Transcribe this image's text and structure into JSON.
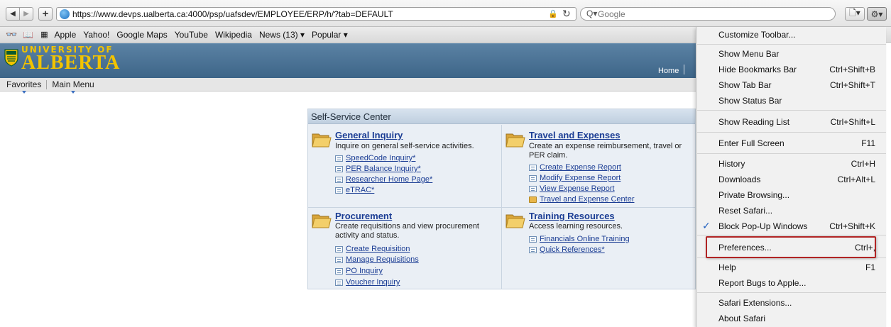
{
  "toolbar": {
    "back_glyph": "◀",
    "forward_glyph": "▶",
    "add_glyph": "+",
    "url": "https://www.devps.ualberta.ca:4000/psp/uafsdev/EMPLOYEE/ERP/h/?tab=DEFAULT",
    "lock_glyph": "🔒",
    "reload_glyph": "↻",
    "search_placeholder": "Google",
    "search_icon_glyph": "Q▾",
    "page_menu_glyph": "🗋▾",
    "gear_glyph": "⚙▾"
  },
  "bookmarks": {
    "reading_list_glyph": "👓",
    "book_glyph": "📖",
    "top_sites_glyph": "▦",
    "items": [
      "Apple",
      "Yahoo!",
      "Google Maps",
      "YouTube",
      "Wikipedia",
      "News (13) ▾",
      "Popular ▾"
    ]
  },
  "banner": {
    "logo_top": "UNIVERSITY OF",
    "logo_bottom": "ALBERTA",
    "home_link": "Home"
  },
  "page_nav": {
    "favorites": "Favorites",
    "main_menu": "Main Menu"
  },
  "ssc": {
    "header": "Self-Service Center",
    "sections": [
      {
        "title": "General Inquiry",
        "desc": "Inquire on general self-service activities.",
        "links": [
          "SpeedCode Inquiry*",
          "PER Balance Inquiry*",
          "Researcher Home Page*",
          "eTRAC*"
        ]
      },
      {
        "title": "Travel and Expenses",
        "desc": "Create an expense reimbursement, travel or PER claim.",
        "links": [
          "Create Expense Report",
          "Modify Expense Report",
          "View Expense Report",
          "Travel and Expense Center"
        ]
      },
      {
        "title": "Procurement",
        "desc": "Create requisitions and view procurement activity and status.",
        "links": [
          "Create Requisition",
          "Manage Requisitions",
          "PO Inquiry",
          "Voucher Inquiry"
        ]
      },
      {
        "title": "Training Resources",
        "desc": "Access learning resources.",
        "links": [
          "Financials Online Training",
          "Quick References*"
        ]
      }
    ]
  },
  "menu": {
    "check_glyph": "✓",
    "items": [
      {
        "label": "Customize Toolbar...",
        "shortcut": ""
      },
      {
        "label": "Show Menu Bar",
        "shortcut": ""
      },
      {
        "label": "Hide Bookmarks Bar",
        "shortcut": "Ctrl+Shift+B"
      },
      {
        "label": "Show Tab Bar",
        "shortcut": "Ctrl+Shift+T"
      },
      {
        "label": "Show Status Bar",
        "shortcut": ""
      },
      {
        "label": "Show Reading List",
        "shortcut": "Ctrl+Shift+L"
      },
      {
        "label": "Enter Full Screen",
        "shortcut": "F11"
      },
      {
        "label": "History",
        "shortcut": "Ctrl+H"
      },
      {
        "label": "Downloads",
        "shortcut": "Ctrl+Alt+L"
      },
      {
        "label": "Private Browsing...",
        "shortcut": ""
      },
      {
        "label": "Reset Safari...",
        "shortcut": ""
      },
      {
        "label": "Block Pop-Up Windows",
        "shortcut": "Ctrl+Shift+K",
        "checked": true
      },
      {
        "label": "Preferences...",
        "shortcut": "Ctrl+,"
      },
      {
        "label": "Help",
        "shortcut": "F1"
      },
      {
        "label": "Report Bugs to Apple...",
        "shortcut": ""
      },
      {
        "label": "Safari Extensions...",
        "shortcut": ""
      },
      {
        "label": "About Safari",
        "shortcut": ""
      }
    ]
  },
  "colors": {
    "banner": "#3d6588",
    "logo_gold": "#f2c300",
    "link_blue": "#1b3d94",
    "highlight_red": "#b12424"
  }
}
